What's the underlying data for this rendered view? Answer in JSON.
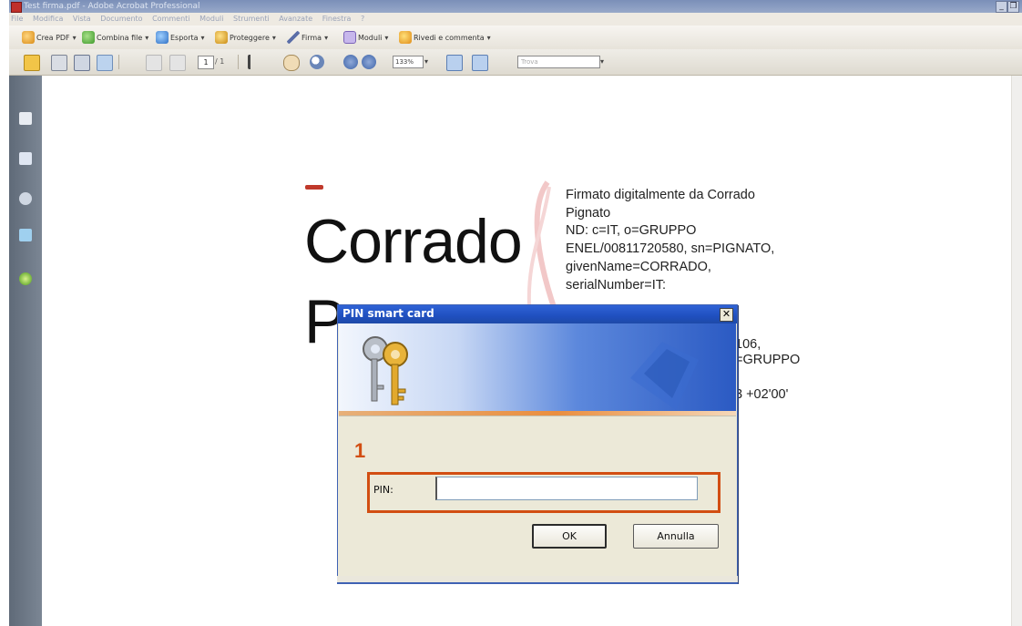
{
  "window": {
    "title": "Test firma.pdf - Adobe Acrobat Professional"
  },
  "menubar": {
    "items": [
      "File",
      "Modifica",
      "Vista",
      "Documento",
      "Commenti",
      "Moduli",
      "Strumenti",
      "Avanzate",
      "Finestra",
      "?"
    ]
  },
  "tasks": {
    "create_pdf": "Crea PDF",
    "combine": "Combina file",
    "export": "Esporta",
    "protect": "Proteggere",
    "sign": "Firma",
    "forms": "Moduli",
    "review": "Rivedi e commenta"
  },
  "toolbar": {
    "page_current": "1",
    "page_total": "/ 1",
    "zoom": "133%",
    "search_placeholder": "Trova"
  },
  "document": {
    "signer_name_line1": "Corrado",
    "signer_name_line2": "P",
    "signature_lines": [
      "Firmato digitalmente da Corrado",
      "Pignato",
      "ND: c=IT, o=GRUPPO",
      "ENEL/00811720580, sn=PIGNATO,",
      "givenName=CORRADO,",
      "serialNumber=IT:"
    ],
    "signature_tail": [
      "106,",
      "=GRUPPO",
      "3 +02'00'"
    ]
  },
  "dialog": {
    "title": "PIN smart card",
    "close": "✕",
    "step": "1",
    "pin_label": "PIN:",
    "pin_value": "",
    "ok_label": "OK",
    "cancel_label": "Annulla"
  },
  "colors": {
    "accent_orange": "#d24e12",
    "dialog_title_blue": "#2f63d6"
  }
}
